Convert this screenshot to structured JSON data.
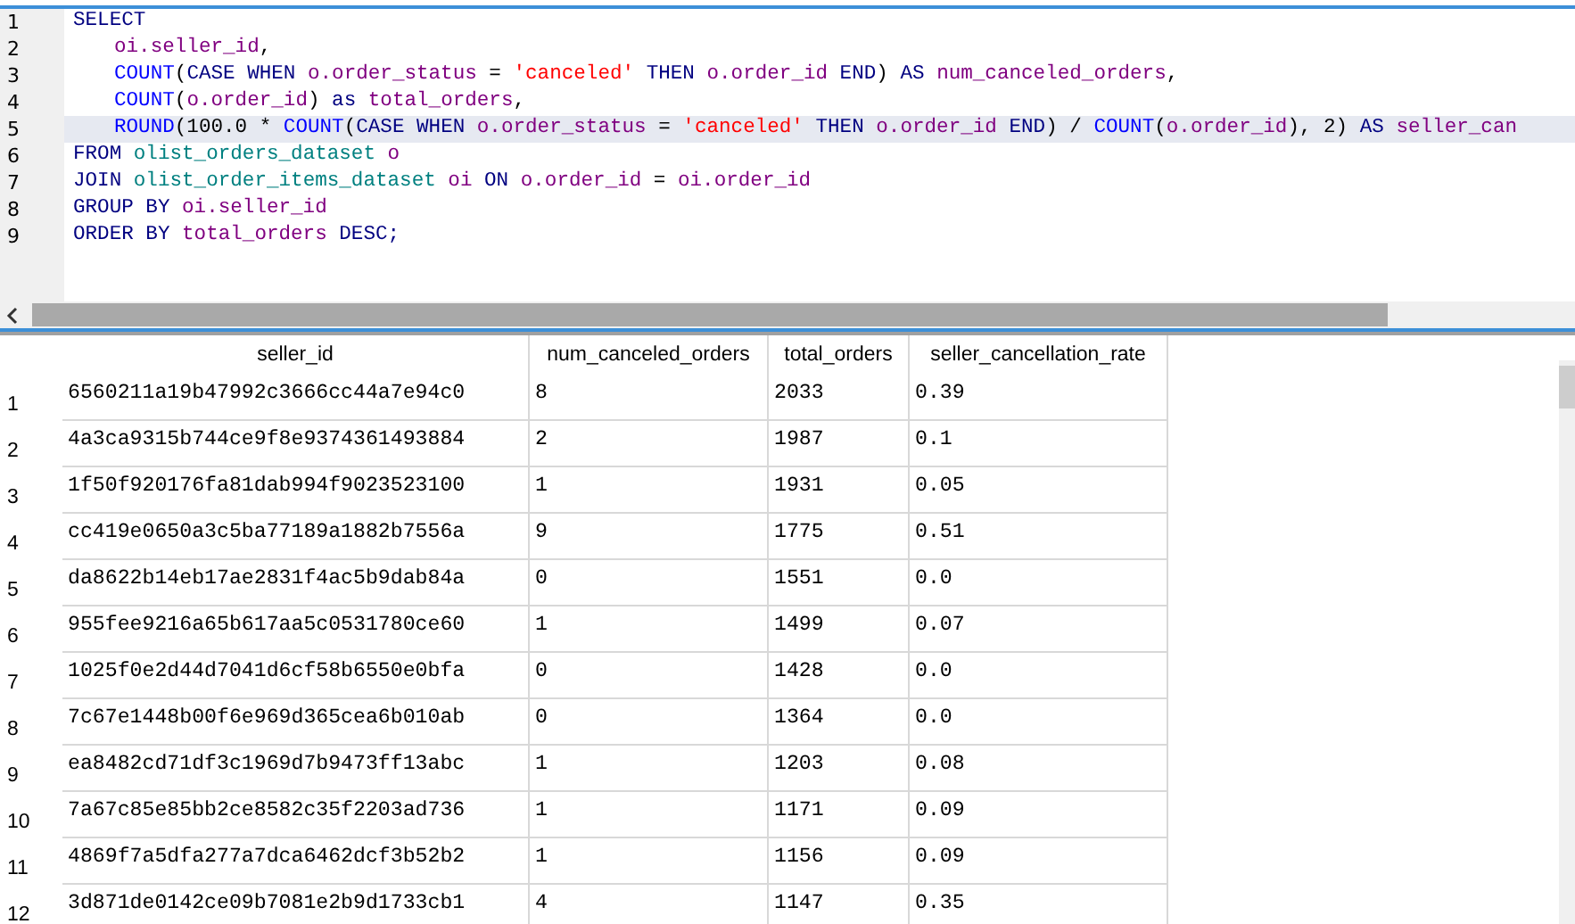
{
  "editor": {
    "lines": [
      {
        "number": "1",
        "current": false,
        "indented": false,
        "tokens": [
          {
            "text": "SELECT",
            "kind": "keyword"
          }
        ]
      },
      {
        "number": "2",
        "current": false,
        "indented": true,
        "tokens": [
          {
            "text": "oi.seller_id",
            "kind": "identifier"
          },
          {
            "text": ",",
            "kind": "plain"
          }
        ]
      },
      {
        "number": "3",
        "current": false,
        "indented": true,
        "tokens": [
          {
            "text": "COUNT",
            "kind": "function"
          },
          {
            "text": "(",
            "kind": "plain"
          },
          {
            "text": "CASE WHEN ",
            "kind": "keyword"
          },
          {
            "text": "o.order_status",
            "kind": "identifier"
          },
          {
            "text": " = ",
            "kind": "plain"
          },
          {
            "text": "'canceled'",
            "kind": "string"
          },
          {
            "text": " THEN ",
            "kind": "keyword"
          },
          {
            "text": "o.order_id",
            "kind": "identifier"
          },
          {
            "text": " END",
            "kind": "keyword"
          },
          {
            "text": ") ",
            "kind": "plain"
          },
          {
            "text": "AS ",
            "kind": "keyword"
          },
          {
            "text": "num_canceled_orders",
            "kind": "identifier"
          },
          {
            "text": ",",
            "kind": "plain"
          }
        ]
      },
      {
        "number": "4",
        "current": false,
        "indented": true,
        "tokens": [
          {
            "text": "COUNT",
            "kind": "function"
          },
          {
            "text": "(",
            "kind": "plain"
          },
          {
            "text": "o.order_id",
            "kind": "identifier"
          },
          {
            "text": ") ",
            "kind": "plain"
          },
          {
            "text": "as ",
            "kind": "keyword"
          },
          {
            "text": "total_orders",
            "kind": "identifier"
          },
          {
            "text": ",",
            "kind": "plain"
          }
        ]
      },
      {
        "number": "5",
        "current": true,
        "indented": true,
        "tokens": [
          {
            "text": "ROUND",
            "kind": "function"
          },
          {
            "text": "(100.0 * ",
            "kind": "plain"
          },
          {
            "text": "COUNT",
            "kind": "function"
          },
          {
            "text": "(",
            "kind": "plain"
          },
          {
            "text": "CASE WHEN ",
            "kind": "keyword"
          },
          {
            "text": "o.order_status",
            "kind": "identifier"
          },
          {
            "text": " = ",
            "kind": "plain"
          },
          {
            "text": "'canceled'",
            "kind": "string"
          },
          {
            "text": " THEN ",
            "kind": "keyword"
          },
          {
            "text": "o.order_id",
            "kind": "identifier"
          },
          {
            "text": " END",
            "kind": "keyword"
          },
          {
            "text": ") / ",
            "kind": "plain"
          },
          {
            "text": "COUNT",
            "kind": "function"
          },
          {
            "text": "(",
            "kind": "plain"
          },
          {
            "text": "o.order_id",
            "kind": "identifier"
          },
          {
            "text": "), 2) ",
            "kind": "plain"
          },
          {
            "text": "AS ",
            "kind": "keyword"
          },
          {
            "text": "seller_can",
            "kind": "identifier"
          }
        ]
      },
      {
        "number": "6",
        "current": false,
        "indented": false,
        "tokens": [
          {
            "text": "FROM ",
            "kind": "keyword"
          },
          {
            "text": "olist_orders_dataset ",
            "kind": "table"
          },
          {
            "text": "o",
            "kind": "identifier"
          }
        ]
      },
      {
        "number": "7",
        "current": false,
        "indented": false,
        "tokens": [
          {
            "text": "JOIN ",
            "kind": "keyword"
          },
          {
            "text": "olist_order_items_dataset ",
            "kind": "table"
          },
          {
            "text": "oi",
            "kind": "identifier"
          },
          {
            "text": " ON ",
            "kind": "keyword"
          },
          {
            "text": "o.order_id",
            "kind": "identifier"
          },
          {
            "text": " = ",
            "kind": "plain"
          },
          {
            "text": "oi.order_id",
            "kind": "identifier"
          }
        ]
      },
      {
        "number": "8",
        "current": false,
        "indented": false,
        "tokens": [
          {
            "text": "GROUP BY ",
            "kind": "keyword"
          },
          {
            "text": "oi.seller_id",
            "kind": "identifier"
          }
        ]
      },
      {
        "number": "9",
        "current": false,
        "indented": false,
        "tokens": [
          {
            "text": "ORDER BY ",
            "kind": "keyword"
          },
          {
            "text": "total_orders",
            "kind": "identifier"
          },
          {
            "text": " DESC;",
            "kind": "keyword"
          }
        ]
      }
    ]
  },
  "results": {
    "columns": [
      "seller_id",
      "num_canceled_orders",
      "total_orders",
      "seller_cancellation_rate"
    ],
    "rows": [
      {
        "number": "1",
        "cells": [
          "6560211a19b47992c3666cc44a7e94c0",
          "8",
          "2033",
          "0.39"
        ]
      },
      {
        "number": "2",
        "cells": [
          "4a3ca9315b744ce9f8e9374361493884",
          "2",
          "1987",
          "0.1"
        ]
      },
      {
        "number": "3",
        "cells": [
          "1f50f920176fa81dab994f9023523100",
          "1",
          "1931",
          "0.05"
        ]
      },
      {
        "number": "4",
        "cells": [
          "cc419e0650a3c5ba77189a1882b7556a",
          "9",
          "1775",
          "0.51"
        ]
      },
      {
        "number": "5",
        "cells": [
          "da8622b14eb17ae2831f4ac5b9dab84a",
          "0",
          "1551",
          "0.0"
        ]
      },
      {
        "number": "6",
        "cells": [
          "955fee9216a65b617aa5c0531780ce60",
          "1",
          "1499",
          "0.07"
        ]
      },
      {
        "number": "7",
        "cells": [
          "1025f0e2d44d7041d6cf58b6550e0bfa",
          "0",
          "1428",
          "0.0"
        ]
      },
      {
        "number": "8",
        "cells": [
          "7c67e1448b00f6e969d365cea6b010ab",
          "0",
          "1364",
          "0.0"
        ]
      },
      {
        "number": "9",
        "cells": [
          "ea8482cd71df3c1969d7b9473ff13abc",
          "1",
          "1203",
          "0.08"
        ]
      },
      {
        "number": "10",
        "cells": [
          "7a67c85e85bb2ce8582c35f2203ad736",
          "1",
          "1171",
          "0.09"
        ]
      },
      {
        "number": "11",
        "cells": [
          "4869f7a5dfa277a7dca6462dcf3b52b2",
          "1",
          "1156",
          "0.09"
        ]
      },
      {
        "number": "12",
        "cells": [
          "3d871de0142ce09b7081e2b9d1733cb1",
          "4",
          "1147",
          "0.35"
        ]
      }
    ]
  }
}
